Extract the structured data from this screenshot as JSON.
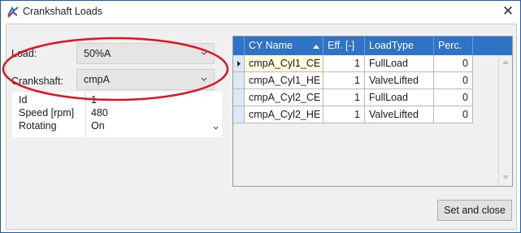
{
  "window": {
    "title": "Crankshaft Loads"
  },
  "form": {
    "load_label": "Load:",
    "load_value": "50%A",
    "crankshaft_label": "Crankshaft:",
    "crankshaft_value": "cmpA"
  },
  "properties": [
    {
      "name": "Id",
      "value": "1"
    },
    {
      "name": "Speed [rpm]",
      "value": "480"
    },
    {
      "name": "Rotating",
      "value": "On"
    }
  ],
  "grid": {
    "columns": [
      {
        "label": "CY Name",
        "sort": "ascending"
      },
      {
        "label": "Eff. [-]"
      },
      {
        "label": "LoadType"
      },
      {
        "label": "Perc."
      }
    ],
    "rows": [
      {
        "cy_name": "cmpA_Cyl1_CE",
        "eff": "1",
        "load_type": "FullLoad",
        "perc": "0"
      },
      {
        "cy_name": "cmpA_Cyl1_HE",
        "eff": "1",
        "load_type": "ValveLifted",
        "perc": "0"
      },
      {
        "cy_name": "cmpA_Cyl2_CE",
        "eff": "1",
        "load_type": "FullLoad",
        "perc": "0"
      },
      {
        "cy_name": "cmpA_Cyl2_HE",
        "eff": "1",
        "load_type": "ValveLifted",
        "perc": "0"
      }
    ]
  },
  "actions": {
    "set_and_close_label": "Set and close"
  },
  "colors": {
    "header_blue": "#2e73c6",
    "annotation_red": "#e0141e",
    "selected_cell": "#fffbdc"
  },
  "icons": {
    "app": "crankshaft-app-icon",
    "close": "close-icon",
    "dropdown": "chevron-down-icon",
    "sort": "sort-ascending-icon",
    "current_row": "row-pointer-icon"
  }
}
